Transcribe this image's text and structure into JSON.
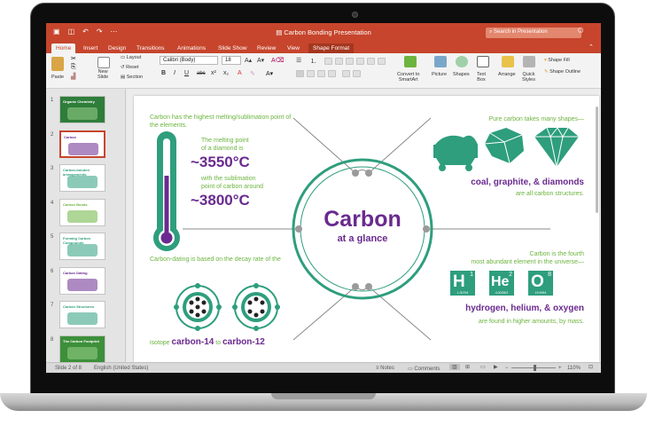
{
  "app": {
    "window_title": "Carbon Bonding Presentation",
    "search_placeholder": "Search in Presentation"
  },
  "tabs": [
    "Home",
    "Insert",
    "Design",
    "Transitions",
    "Animations",
    "Slide Show",
    "Review",
    "View",
    "Shape Format"
  ],
  "ribbon": {
    "paste": "Paste",
    "new_slide_line1": "New",
    "new_slide_line2": "Slide",
    "layout": "Layout",
    "reset": "Reset",
    "section": "Section",
    "font_name": "Calibri (Body)",
    "font_size": "18",
    "convert_line1": "Convert to",
    "convert_line2": "SmartArt",
    "picture": "Picture",
    "shapes": "Shapes",
    "textbox_line1": "Text",
    "textbox_line2": "Box",
    "arrange": "Arrange",
    "quick_styles_line1": "Quick",
    "quick_styles_line2": "Styles",
    "shape_fill": "Shape Fill",
    "shape_outline": "Shape Outline"
  },
  "thumbnails": [
    {
      "num": "1",
      "caption": "Organic Chemistry"
    },
    {
      "num": "2",
      "caption": "Carbon"
    },
    {
      "num": "3",
      "caption": "Carbon-bonded arrangements"
    },
    {
      "num": "4",
      "caption": "Carbon Bonds"
    },
    {
      "num": "5",
      "caption": "Forming Carbon Compounds"
    },
    {
      "num": "6",
      "caption": "Carbon Dating"
    },
    {
      "num": "7",
      "caption": "Carbon Structures"
    },
    {
      "num": "8",
      "caption": "The Carbon Footprint"
    }
  ],
  "slide": {
    "center_title": "Carbon",
    "center_subtitle": "at a glance",
    "tl_text1": "Carbon has the highest melting/sublimation point of",
    "tl_text2": "the elements.",
    "melt_line1": "The melting point",
    "melt_line2": "of a diamond is",
    "melt_value": "~3550°C",
    "sub_line1": "with the sublimation",
    "sub_line2": "point of carbon around",
    "sub_value": "~3800°C",
    "tr_text": "Pure carbon takes many shapes—",
    "tr_shapes": "coal, graphite, & diamonds",
    "tr_caption": "are all carbon structures.",
    "bl_text": "Carbon-dating is based on the decay rate of the",
    "bl_isotope_prefix": "isotope",
    "bl_c14": "carbon-14",
    "bl_to": "to",
    "bl_c12": "carbon-12",
    "br_text1": "Carbon is the fourth",
    "br_text2": "most abundant element in the universe—",
    "br_elements": "hydrogen, helium, & oxygen",
    "br_caption": "are found in higher amounts, by mass.",
    "elements": [
      {
        "symbol": "H",
        "number": "1",
        "mass": "1.00794"
      },
      {
        "symbol": "He",
        "number": "2",
        "mass": "4.002602"
      },
      {
        "symbol": "O",
        "number": "8",
        "mass": "15.9994"
      }
    ]
  },
  "status": {
    "slide_info": "Slide 2 of 8",
    "language": "English (United States)",
    "notes": "Notes",
    "comments": "Comments",
    "zoom": "110%"
  },
  "colors": {
    "accent": "#c6452c",
    "teal": "#2e9e7d",
    "purple": "#6a2a8f",
    "green": "#6cb43f"
  }
}
